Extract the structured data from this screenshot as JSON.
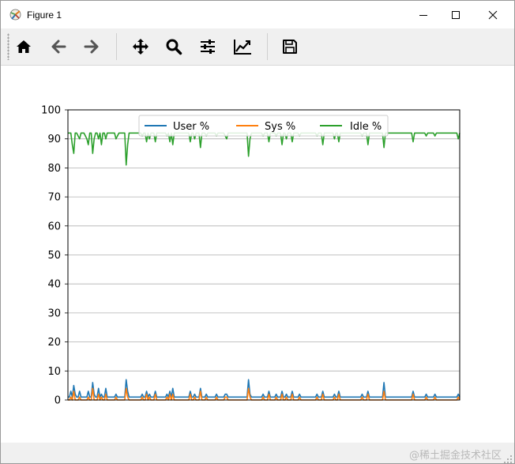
{
  "window": {
    "title": "Figure 1",
    "controls": {
      "minimize": "minimize",
      "maximize": "maximize",
      "close": "close"
    }
  },
  "toolbar": {
    "buttons": [
      {
        "name": "home",
        "icon": "home-icon"
      },
      {
        "name": "back",
        "icon": "arrow-left-icon"
      },
      {
        "name": "forward",
        "icon": "arrow-right-icon"
      },
      {
        "name": "pan",
        "icon": "move-icon"
      },
      {
        "name": "zoom",
        "icon": "magnifier-icon"
      },
      {
        "name": "configure-subplots",
        "icon": "sliders-icon"
      },
      {
        "name": "edit-axis",
        "icon": "line-chart-icon"
      },
      {
        "name": "save",
        "icon": "floppy-disk-icon"
      }
    ]
  },
  "statusbar": {
    "watermark": "@稀土掘金技术社区"
  },
  "chart_data": {
    "type": "line",
    "title": "",
    "xlabel": "",
    "ylabel": "",
    "ylim": [
      0,
      100
    ],
    "yticks": [
      "0",
      "10",
      "20",
      "30",
      "40",
      "50",
      "60",
      "70",
      "80",
      "90",
      "100"
    ],
    "x_ticks_visible": false,
    "grid": {
      "y": true,
      "x": false
    },
    "legend": {
      "location": "upper center",
      "columns": 3
    },
    "colors": {
      "User %": "#1f77b4",
      "Sys %": "#ff7f0e",
      "Idle %": "#2ca02c"
    },
    "series": [
      {
        "name": "User %",
        "color": "#1f77b4",
        "values": [
          1,
          1,
          3,
          1,
          5,
          2,
          1,
          1,
          3,
          1,
          1,
          1,
          1,
          1,
          3,
          1,
          1,
          6,
          2,
          1,
          1,
          4,
          1,
          2,
          1,
          1,
          4,
          1,
          1,
          1,
          1,
          1,
          1,
          2,
          1,
          1,
          1,
          1,
          1,
          1,
          7,
          3,
          1,
          1,
          1,
          1,
          1,
          1,
          1,
          1,
          1,
          2,
          1,
          1,
          3,
          1,
          2,
          1,
          1,
          1,
          3,
          1,
          1,
          1,
          1,
          1,
          1,
          1,
          2,
          1,
          3,
          1,
          4,
          1,
          1,
          1,
          1,
          1,
          1,
          1,
          1,
          1,
          1,
          1,
          3,
          1,
          1,
          2,
          1,
          1,
          1,
          4,
          1,
          1,
          1,
          2,
          1,
          1,
          1,
          1,
          1,
          1,
          2,
          1,
          1,
          1,
          1,
          1,
          2,
          2,
          1,
          1,
          1,
          1,
          1,
          1,
          1,
          1,
          1,
          1,
          1,
          1,
          1,
          1,
          7,
          2,
          1,
          1,
          1,
          1,
          1,
          1,
          1,
          1,
          2,
          1,
          1,
          1,
          3,
          1,
          1,
          1,
          1,
          2,
          1,
          1,
          1,
          3,
          1,
          1,
          2,
          1,
          1,
          1,
          3,
          1,
          1,
          1,
          1,
          2,
          1,
          1,
          1,
          1,
          1,
          1,
          1,
          1,
          1,
          1,
          1,
          2,
          1,
          1,
          1,
          3,
          1,
          1,
          1,
          1,
          1,
          1,
          1,
          2,
          1,
          1,
          3,
          1,
          1,
          1,
          1,
          1,
          1,
          1,
          1,
          1,
          1,
          1,
          1,
          1,
          1,
          1,
          2,
          1,
          1,
          1,
          3,
          1,
          1,
          1,
          1,
          1,
          1,
          1,
          1,
          1,
          1,
          6,
          1,
          1,
          1,
          1,
          1,
          1,
          1,
          1,
          1,
          1,
          1,
          1,
          1,
          1,
          1,
          1,
          1,
          1,
          1,
          3,
          1,
          1,
          1,
          1,
          1,
          1,
          1,
          1,
          2,
          1,
          1,
          1,
          1,
          1,
          2,
          1,
          1,
          1,
          1,
          1,
          1,
          1,
          1,
          1,
          1,
          1,
          1,
          1,
          1,
          1,
          2,
          1
        ]
      },
      {
        "name": "Sys %",
        "color": "#ff7f0e",
        "values": [
          0,
          0,
          1,
          0,
          3,
          0,
          0,
          0,
          1,
          0,
          0,
          0,
          0,
          0,
          1,
          0,
          0,
          4,
          0,
          0,
          0,
          2,
          0,
          1,
          0,
          0,
          2,
          0,
          0,
          0,
          0,
          0,
          0,
          1,
          0,
          0,
          0,
          0,
          0,
          0,
          4,
          1,
          0,
          0,
          0,
          0,
          0,
          0,
          0,
          0,
          0,
          1,
          0,
          0,
          2,
          0,
          1,
          0,
          0,
          0,
          2,
          0,
          0,
          0,
          0,
          0,
          0,
          0,
          1,
          0,
          2,
          0,
          2,
          0,
          0,
          0,
          0,
          0,
          0,
          0,
          0,
          0,
          0,
          0,
          2,
          0,
          0,
          1,
          0,
          0,
          0,
          3,
          0,
          0,
          0,
          1,
          0,
          0,
          0,
          0,
          0,
          0,
          1,
          0,
          0,
          0,
          0,
          0,
          1,
          1,
          0,
          0,
          0,
          0,
          0,
          0,
          0,
          0,
          0,
          0,
          0,
          0,
          0,
          0,
          4,
          1,
          0,
          0,
          0,
          0,
          0,
          0,
          0,
          0,
          1,
          0,
          0,
          0,
          2,
          0,
          0,
          0,
          0,
          1,
          0,
          0,
          0,
          2,
          0,
          0,
          1,
          0,
          0,
          0,
          2,
          0,
          0,
          0,
          0,
          1,
          0,
          0,
          0,
          0,
          0,
          0,
          0,
          0,
          0,
          0,
          0,
          1,
          0,
          0,
          0,
          2,
          0,
          0,
          0,
          0,
          0,
          0,
          0,
          1,
          0,
          0,
          2,
          0,
          0,
          0,
          0,
          0,
          0,
          0,
          0,
          0,
          0,
          0,
          0,
          0,
          0,
          0,
          1,
          0,
          0,
          0,
          2,
          0,
          0,
          0,
          0,
          0,
          0,
          0,
          0,
          0,
          0,
          3,
          0,
          0,
          0,
          0,
          0,
          0,
          0,
          0,
          0,
          0,
          0,
          0,
          0,
          0,
          0,
          0,
          0,
          0,
          0,
          2,
          0,
          0,
          0,
          0,
          0,
          0,
          0,
          0,
          1,
          0,
          0,
          0,
          0,
          0,
          1,
          0,
          0,
          0,
          0,
          0,
          0,
          0,
          0,
          0,
          0,
          0,
          0,
          0,
          0,
          0,
          1,
          0
        ]
      },
      {
        "name": "Idle %",
        "color": "#2ca02c",
        "values": [
          92,
          92,
          92,
          88,
          85,
          92,
          92,
          91,
          90,
          92,
          92,
          92,
          91,
          90,
          88,
          92,
          92,
          85,
          90,
          92,
          92,
          90,
          92,
          88,
          92,
          92,
          90,
          92,
          92,
          92,
          92,
          92,
          92,
          90,
          91,
          92,
          92,
          92,
          92,
          92,
          81,
          88,
          92,
          92,
          92,
          92,
          92,
          92,
          92,
          92,
          92,
          91,
          92,
          92,
          89,
          92,
          90,
          92,
          92,
          92,
          89,
          92,
          92,
          92,
          92,
          92,
          92,
          92,
          91,
          92,
          89,
          92,
          88,
          92,
          92,
          92,
          92,
          92,
          92,
          92,
          92,
          92,
          92,
          92,
          89,
          92,
          92,
          90,
          92,
          92,
          92,
          87,
          92,
          92,
          92,
          91,
          92,
          92,
          92,
          92,
          92,
          92,
          91,
          92,
          92,
          92,
          92,
          92,
          91,
          90,
          92,
          92,
          92,
          92,
          92,
          92,
          92,
          92,
          92,
          92,
          92,
          92,
          92,
          92,
          84,
          90,
          92,
          92,
          92,
          92,
          92,
          92,
          92,
          92,
          91,
          92,
          92,
          92,
          89,
          92,
          92,
          92,
          92,
          91,
          92,
          92,
          92,
          88,
          92,
          92,
          90,
          92,
          92,
          92,
          89,
          92,
          92,
          92,
          92,
          91,
          92,
          92,
          92,
          92,
          92,
          92,
          92,
          92,
          92,
          92,
          92,
          91,
          92,
          92,
          92,
          88,
          92,
          92,
          92,
          92,
          92,
          92,
          92,
          90,
          92,
          92,
          89,
          92,
          92,
          92,
          92,
          92,
          92,
          92,
          92,
          92,
          92,
          92,
          92,
          92,
          92,
          92,
          91,
          92,
          92,
          92,
          88,
          92,
          92,
          92,
          92,
          92,
          92,
          92,
          92,
          92,
          92,
          87,
          92,
          92,
          92,
          92,
          92,
          92,
          92,
          92,
          92,
          92,
          92,
          92,
          92,
          92,
          92,
          92,
          92,
          92,
          92,
          89,
          92,
          92,
          92,
          92,
          92,
          92,
          92,
          92,
          91,
          92,
          92,
          92,
          92,
          92,
          91,
          92,
          92,
          92,
          92,
          92,
          92,
          92,
          92,
          92,
          92,
          92,
          92,
          92,
          92,
          92,
          90,
          92
        ]
      }
    ]
  }
}
